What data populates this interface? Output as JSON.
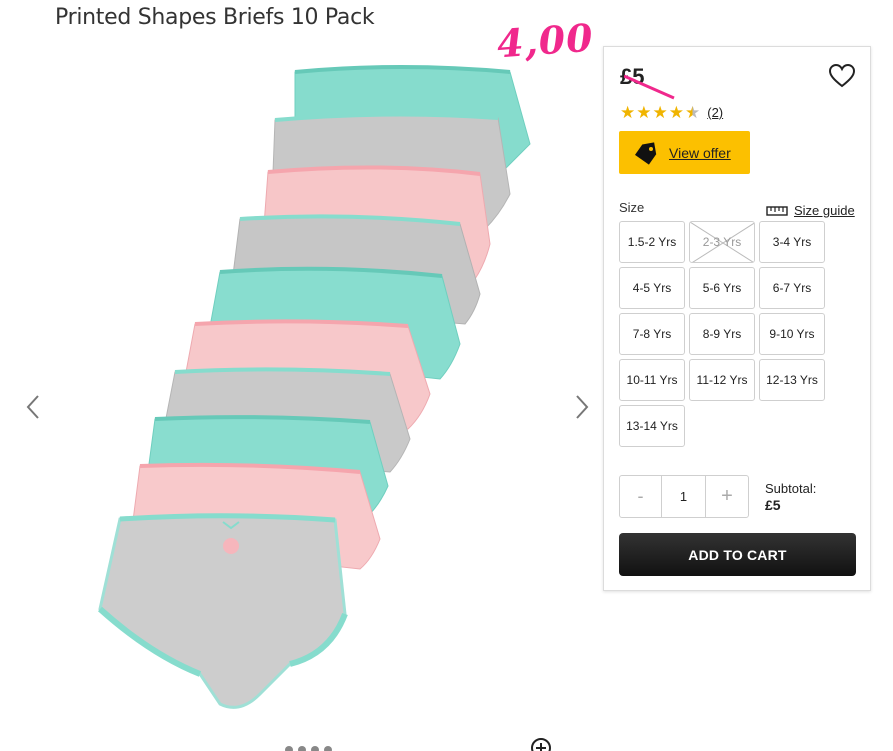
{
  "product": {
    "title": "Printed Shapes Briefs 10 Pack",
    "sale_price_annotation": "4,00",
    "old_price": "£5",
    "rating_stars": 4.5,
    "review_count": "(2)",
    "offer_label": "View offer"
  },
  "size": {
    "label": "Size",
    "guide_label": "Size guide",
    "options": [
      {
        "label": "1.5-2 Yrs",
        "available": true
      },
      {
        "label": "2-3 Yrs",
        "available": false
      },
      {
        "label": "3-4 Yrs",
        "available": true
      },
      {
        "label": "4-5 Yrs",
        "available": true
      },
      {
        "label": "5-6 Yrs",
        "available": true
      },
      {
        "label": "6-7 Yrs",
        "available": true
      },
      {
        "label": "7-8 Yrs",
        "available": true
      },
      {
        "label": "8-9 Yrs",
        "available": true
      },
      {
        "label": "9-10 Yrs",
        "available": true
      },
      {
        "label": "10-11 Yrs",
        "available": true
      },
      {
        "label": "11-12 Yrs",
        "available": true
      },
      {
        "label": "12-13 Yrs",
        "available": true
      },
      {
        "label": "13-14 Yrs",
        "available": true
      }
    ]
  },
  "quantity": {
    "minus": "-",
    "value": "1",
    "plus": "+"
  },
  "subtotal": {
    "label": "Subtotal:",
    "amount": "£5"
  },
  "cart": {
    "add_label": "ADD TO CART"
  },
  "colors": {
    "annotation_pink": "#f0288c",
    "offer_yellow": "#fcc000",
    "star_gold": "#f0b400",
    "mint": "#7fdccf",
    "grey": "#c9c9c9",
    "pink": "#f6c1c4"
  },
  "icons": {
    "prev": "chevron-left-icon",
    "next": "chevron-right-icon",
    "wishlist": "heart-outline-icon",
    "offer": "price-tag-icon",
    "size_guide": "ruler-icon",
    "zoom": "zoom-in-icon"
  }
}
